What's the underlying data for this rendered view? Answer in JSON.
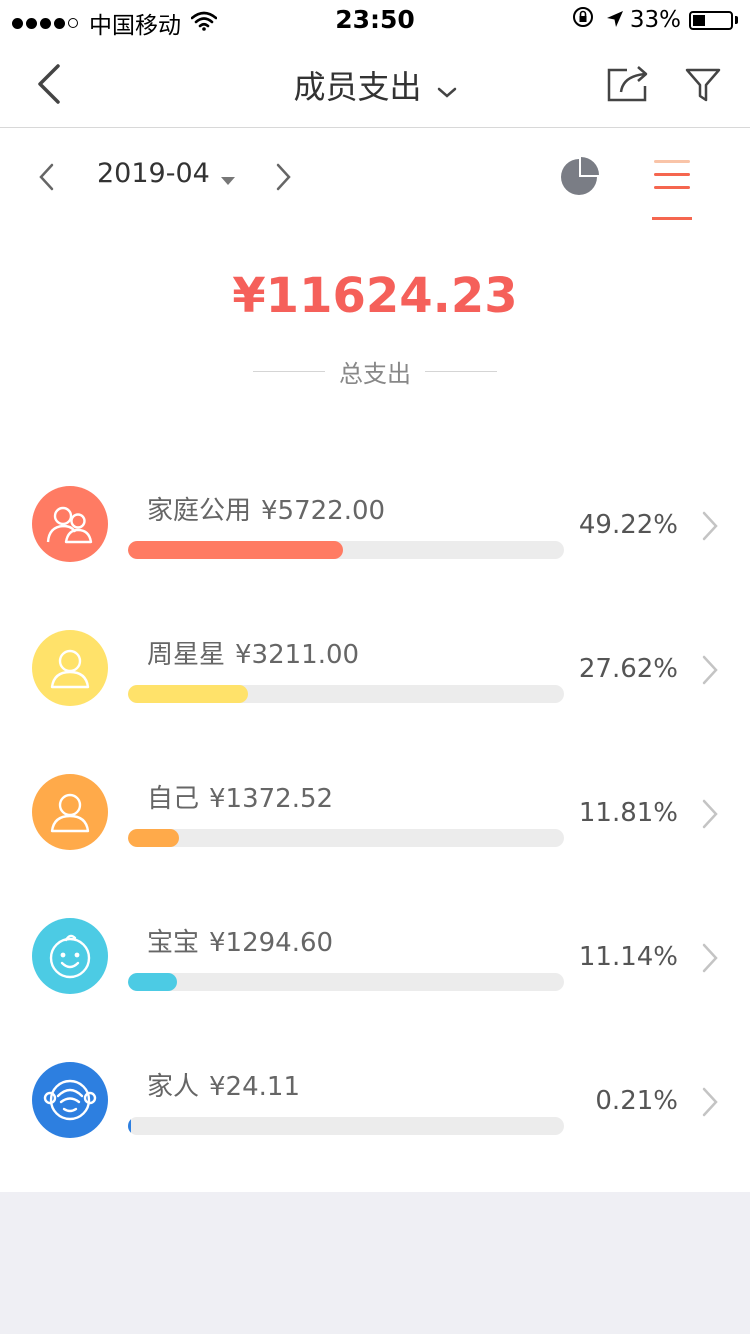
{
  "status_bar": {
    "carrier": "中国移动",
    "time": "23:50",
    "battery_percent": "33%",
    "battery_level": 0.33
  },
  "nav": {
    "title": "成员支出"
  },
  "date_selector": {
    "value": "2019-04"
  },
  "summary": {
    "total_amount": "¥11624.23",
    "total_label": "总支出"
  },
  "colors": {
    "accent_red": "#f5605a",
    "tab_active": "#f5664f"
  },
  "members": [
    {
      "name": "家庭公用",
      "amount": "¥5722.00",
      "percent": "49.22%",
      "fraction": 0.4922,
      "color": "#ff7b63",
      "icon": "family-icon"
    },
    {
      "name": "周星星",
      "amount": "¥3211.00",
      "percent": "27.62%",
      "fraction": 0.2762,
      "color": "#ffe26a",
      "icon": "person-icon"
    },
    {
      "name": "自己",
      "amount": "¥1372.52",
      "percent": "11.81%",
      "fraction": 0.1181,
      "color": "#ffaa4a",
      "icon": "person-icon"
    },
    {
      "name": "宝宝",
      "amount": "¥1294.60",
      "percent": "11.14%",
      "fraction": 0.1114,
      "color": "#4ccbe4",
      "icon": "baby-icon"
    },
    {
      "name": "家人",
      "amount": "¥24.11",
      "percent": "0.21%",
      "fraction": 0.0021,
      "color": "#2d7fe0",
      "icon": "monkey-face-icon"
    }
  ]
}
